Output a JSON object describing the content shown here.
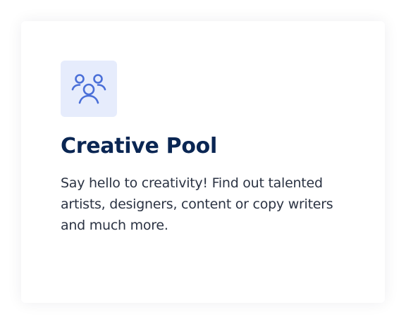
{
  "card": {
    "icon": "users-group-icon",
    "title": "Creative Pool",
    "description": "Say hello to creativity! Find out talented artists, designers, content or copy writers and much more."
  },
  "colors": {
    "icon_tile_bg": "#e6ecfc",
    "icon_stroke": "#4a6fd8",
    "title": "#0a2653",
    "text": "#2b3343"
  }
}
